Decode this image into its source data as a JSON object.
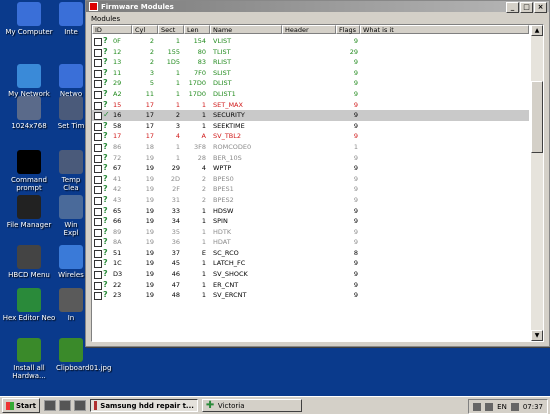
{
  "desktop": {
    "icons": [
      {
        "label": "My Computer",
        "icon": "my-computer-icon",
        "color": "#3a6fd8"
      },
      {
        "label": "My Network Places",
        "icon": "network-places-icon",
        "color": "#3a8ad8"
      },
      {
        "label": "1024x768",
        "icon": "monitor-icon",
        "color": "#5a6a8a"
      },
      {
        "label": "Command prompt",
        "icon": "command-prompt-icon",
        "color": "#000000"
      },
      {
        "label": "File Manager",
        "icon": "file-manager-icon",
        "color": "#222222"
      },
      {
        "label": "HBCD Menu",
        "icon": "hbcd-menu-icon",
        "color": "#444444"
      },
      {
        "label": "Hex Editor Neo",
        "icon": "hex-editor-icon",
        "color": "#2a8a3a"
      },
      {
        "label": "Install all Hardwa...",
        "icon": "install-hardware-icon",
        "color": "#3a8a2a"
      }
    ],
    "icons_col2": [
      {
        "label": "Inte",
        "icon": "internet-icon",
        "color": "#3a6fd8"
      },
      {
        "label": "Netwo",
        "icon": "network-icon",
        "color": "#3a6fd8"
      },
      {
        "label": "Set Tim",
        "icon": "set-time-icon",
        "color": "#4a5a7a"
      },
      {
        "label": "Temp Clea",
        "icon": "temp-cleaner-icon",
        "color": "#4a5a7a"
      },
      {
        "label": "Win Expl",
        "icon": "windows-explorer-icon",
        "color": "#4a6a9a"
      },
      {
        "label": "Wireles",
        "icon": "wireless-icon",
        "color": "#3a7ad8"
      },
      {
        "label": "In",
        "icon": "in-icon",
        "color": "#5a5a5a"
      },
      {
        "label": "Clipboard01.jpg",
        "icon": "image-file-icon",
        "color": "#3a8a2a"
      }
    ]
  },
  "window": {
    "title": "Firmware Modules",
    "group_label": "Modules",
    "columns": [
      "ID",
      "Cyl",
      "Sect",
      "Len",
      "Name",
      "Header",
      "Flags",
      "What is it"
    ],
    "rows": [
      {
        "id": "0F",
        "cyl": "2",
        "sect": "1",
        "len": "154",
        "name": "VLIST",
        "header": "",
        "flags": "9",
        "color": "green",
        "mark": "?"
      },
      {
        "id": "12",
        "cyl": "2",
        "sect": "155",
        "len": "80",
        "name": "TLIST",
        "header": "",
        "flags": "29",
        "color": "green",
        "mark": "?"
      },
      {
        "id": "13",
        "cyl": "2",
        "sect": "1D5",
        "len": "83",
        "name": "RLIST",
        "header": "",
        "flags": "9",
        "color": "green",
        "mark": "?"
      },
      {
        "id": "11",
        "cyl": "3",
        "sect": "1",
        "len": "7F0",
        "name": "SLIST",
        "header": "",
        "flags": "9",
        "color": "green",
        "mark": "?"
      },
      {
        "id": "29",
        "cyl": "5",
        "sect": "1",
        "len": "17D0",
        "name": "DLIST",
        "header": "",
        "flags": "9",
        "color": "green",
        "mark": "?"
      },
      {
        "id": "A2",
        "cyl": "11",
        "sect": "1",
        "len": "17D0",
        "name": "DLIST1",
        "header": "",
        "flags": "9",
        "color": "green",
        "mark": "?"
      },
      {
        "id": "15",
        "cyl": "17",
        "sect": "1",
        "len": "1",
        "name": "SET_MAX",
        "header": "",
        "flags": "9",
        "color": "red",
        "mark": "?"
      },
      {
        "id": "16",
        "cyl": "17",
        "sect": "2",
        "len": "1",
        "name": "SECURITY",
        "header": "",
        "flags": "9",
        "color": "black",
        "mark": "✓",
        "selected": true
      },
      {
        "id": "58",
        "cyl": "17",
        "sect": "3",
        "len": "1",
        "name": "SEEKTIME",
        "header": "",
        "flags": "9",
        "color": "black",
        "mark": "?"
      },
      {
        "id": "17",
        "cyl": "17",
        "sect": "4",
        "len": "A",
        "name": "SV_TBL2",
        "header": "",
        "flags": "9",
        "color": "red",
        "mark": "?"
      },
      {
        "id": "86",
        "cyl": "18",
        "sect": "1",
        "len": "3F8",
        "name": "ROMCODE0",
        "header": "",
        "flags": "1",
        "color": "grey",
        "mark": "?"
      },
      {
        "id": "72",
        "cyl": "19",
        "sect": "1",
        "len": "28",
        "name": "BER_10S",
        "header": "",
        "flags": "9",
        "color": "grey",
        "mark": "?"
      },
      {
        "id": "67",
        "cyl": "19",
        "sect": "29",
        "len": "4",
        "name": "WPTP",
        "header": "",
        "flags": "9",
        "color": "black",
        "mark": "?"
      },
      {
        "id": "41",
        "cyl": "19",
        "sect": "2D",
        "len": "2",
        "name": "BPES0",
        "header": "",
        "flags": "9",
        "color": "grey",
        "mark": "?"
      },
      {
        "id": "42",
        "cyl": "19",
        "sect": "2F",
        "len": "2",
        "name": "BPES1",
        "header": "",
        "flags": "9",
        "color": "grey",
        "mark": "?"
      },
      {
        "id": "43",
        "cyl": "19",
        "sect": "31",
        "len": "2",
        "name": "BPES2",
        "header": "",
        "flags": "9",
        "color": "grey",
        "mark": "?"
      },
      {
        "id": "65",
        "cyl": "19",
        "sect": "33",
        "len": "1",
        "name": "HDSW",
        "header": "",
        "flags": "9",
        "color": "black",
        "mark": "?"
      },
      {
        "id": "66",
        "cyl": "19",
        "sect": "34",
        "len": "1",
        "name": "SPIN",
        "header": "",
        "flags": "9",
        "color": "black",
        "mark": "?"
      },
      {
        "id": "89",
        "cyl": "19",
        "sect": "35",
        "len": "1",
        "name": "HDTK",
        "header": "",
        "flags": "9",
        "color": "grey",
        "mark": "?"
      },
      {
        "id": "8A",
        "cyl": "19",
        "sect": "36",
        "len": "1",
        "name": "HDAT",
        "header": "",
        "flags": "9",
        "color": "grey",
        "mark": "?"
      },
      {
        "id": "51",
        "cyl": "19",
        "sect": "37",
        "len": "E",
        "name": "SC_RCO",
        "header": "",
        "flags": "8",
        "color": "black",
        "mark": "?"
      },
      {
        "id": "1C",
        "cyl": "19",
        "sect": "45",
        "len": "1",
        "name": "LATCH_FC",
        "header": "",
        "flags": "9",
        "color": "black",
        "mark": "?"
      },
      {
        "id": "D3",
        "cyl": "19",
        "sect": "46",
        "len": "1",
        "name": "SV_SHOCK",
        "header": "",
        "flags": "9",
        "color": "black",
        "mark": "?"
      },
      {
        "id": "22",
        "cyl": "19",
        "sect": "47",
        "len": "1",
        "name": "ER_CNT",
        "header": "",
        "flags": "9",
        "color": "black",
        "mark": "?"
      },
      {
        "id": "23",
        "cyl": "19",
        "sect": "48",
        "len": "1",
        "name": "SV_ERCNT",
        "header": "",
        "flags": "9",
        "color": "black",
        "mark": "?"
      }
    ]
  },
  "taskbar": {
    "start_label": "Start",
    "quick_launch": [
      "ql-1",
      "ql-2",
      "ql-3"
    ],
    "tasks": [
      {
        "label": "Samsung hdd repair t...",
        "active": true
      },
      {
        "label": "Victoria",
        "active": false
      }
    ],
    "tray": {
      "lang": "EN",
      "time": "07:37"
    }
  },
  "colors": {
    "green": "#208a1c",
    "red": "#d01818",
    "grey": "#8a8a8a",
    "black": "#000000"
  }
}
